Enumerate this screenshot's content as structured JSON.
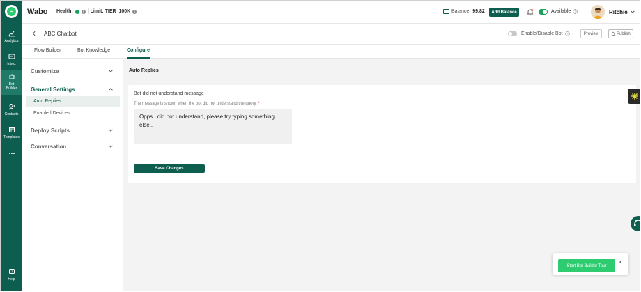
{
  "app": {
    "name": "Wabo"
  },
  "topbar": {
    "health_label": "Health:",
    "limit_label": "| Limit: TIER_100K",
    "balance_label": "Balance:",
    "balance_value": "99.82",
    "add_balance_label": "Add Balance",
    "availability_label": "Available",
    "user_name": "Ritchie"
  },
  "rail": {
    "items": [
      {
        "label": "Analytics"
      },
      {
        "label": "Inbox"
      },
      {
        "label": "Bot Builder"
      },
      {
        "label": "Contacts"
      },
      {
        "label": "Templates"
      },
      {
        "label": "Help"
      }
    ]
  },
  "subheader": {
    "bot_name": "ABC Chatbot",
    "enable_label": "Enable/Disable Bot",
    "preview_label": "Preview",
    "publish_label": "Publish"
  },
  "tabs": [
    {
      "label": "Flow Builder"
    },
    {
      "label": "Bot Knowledge"
    },
    {
      "label": "Configure"
    }
  ],
  "menu": {
    "customize": "Customize",
    "general_settings": "General Settings",
    "auto_replies": "Auto Replies",
    "enabled_devices": "Enabled Devices",
    "deploy_scripts": "Deploy Scripts",
    "conversation": "Conversation"
  },
  "main": {
    "section_title": "Auto Replies",
    "card_title": "Bot did not understand message",
    "card_description": "The message is shown when the bot did not understand the query.",
    "required_mark": "*",
    "message_value": "Opps I did not understand, please try typing something else..",
    "save_label": "Save Changes"
  },
  "tour": {
    "button_label": "Start Bot Builder Tour",
    "close_label": "×"
  },
  "colors": {
    "brand": "#0d5e4e",
    "accent_green": "#2ecc71",
    "status_green": "#1aa05a"
  }
}
